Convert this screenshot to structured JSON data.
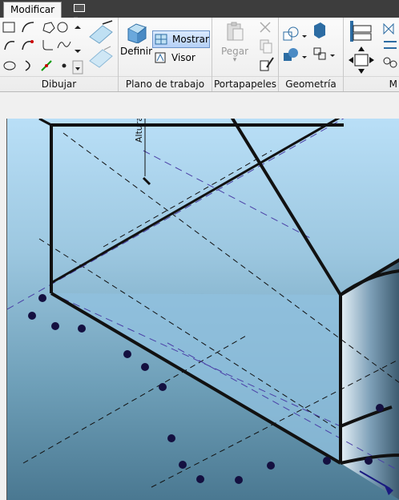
{
  "tabs": {
    "active": "Modificar"
  },
  "panels": {
    "draw": {
      "label": "Dibujar"
    },
    "workplane": {
      "label": "Plano de trabajo",
      "define_label": "Definir",
      "show_label": "Mostrar",
      "viewer_label": "Visor"
    },
    "clipboard": {
      "label": "Portapapeles",
      "paste_label": "Pegar"
    },
    "geometry": {
      "label": "Geometría"
    },
    "modify": {
      "label": "M"
    }
  },
  "viewport": {
    "height_label": "Altura"
  }
}
